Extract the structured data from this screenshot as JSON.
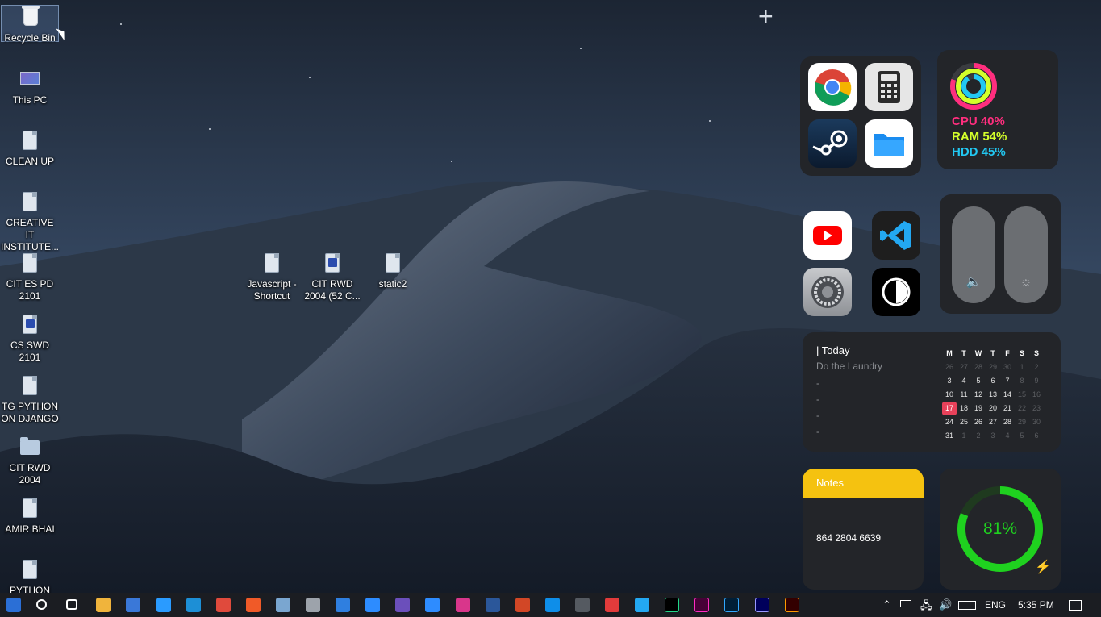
{
  "desktop_icons": [
    {
      "label": "Recycle Bin",
      "icon": "recycle-bin-icon"
    },
    {
      "label": "This PC",
      "icon": "computer-icon"
    },
    {
      "label": "CLEAN UP",
      "icon": "file-icon"
    },
    {
      "label": "CREATIVE IT INSTITUTE...",
      "icon": "file-icon"
    },
    {
      "label": "CIT ES PD 2101",
      "icon": "file-icon"
    },
    {
      "label": "CS SWD 2101",
      "icon": "document-icon"
    },
    {
      "label": "TG PYTHON ON DJANGO",
      "icon": "file-icon"
    },
    {
      "label": "CIT RWD 2004",
      "icon": "folder-icon"
    },
    {
      "label": "AMIR BHAI",
      "icon": "file-icon"
    },
    {
      "label": "PYTHON",
      "icon": "file-icon"
    },
    {
      "label": "Javascript - Shortcut",
      "icon": "file-icon"
    },
    {
      "label": "CIT RWD 2004 (52 C...",
      "icon": "document-icon"
    },
    {
      "label": "static2",
      "icon": "file-icon"
    }
  ],
  "widgets": {
    "apps_top": [
      "Chrome",
      "Calculator",
      "Steam",
      "Files"
    ],
    "apps_bottom": [
      "YouTube",
      "Visual Studio Code",
      "Settings",
      "Dark Mode"
    ],
    "system": {
      "cpu": "CPU 40%",
      "ram": "RAM 54%",
      "hdd": "HDD 45%",
      "cpu_value": 40,
      "ram_value": 54,
      "hdd_value": 45,
      "cpu_color": "#ff2e7e",
      "ram_color": "#d4ff2a",
      "hdd_color": "#22c8f2"
    },
    "sliders": {
      "volume_icon": "speaker-icon",
      "brightness_icon": "sun-icon",
      "volume_level": 0,
      "brightness_level": 0
    },
    "today": {
      "title": "| Today",
      "task": "Do the Laundry",
      "placeholders": [
        "-",
        "-",
        "-",
        "-"
      ]
    },
    "calendar": {
      "weekdays": [
        "M",
        "T",
        "W",
        "T",
        "F",
        "S",
        "S"
      ],
      "weeks": [
        [
          "26",
          "27",
          "28",
          "29",
          "30",
          "1",
          "2"
        ],
        [
          "3",
          "4",
          "5",
          "6",
          "7",
          "8",
          "9"
        ],
        [
          "10",
          "11",
          "12",
          "13",
          "14",
          "15",
          "16"
        ],
        [
          "17",
          "18",
          "19",
          "20",
          "21",
          "22",
          "23"
        ],
        [
          "24",
          "25",
          "26",
          "27",
          "28",
          "29",
          "30"
        ],
        [
          "31",
          "1",
          "2",
          "3",
          "4",
          "5",
          "6"
        ]
      ],
      "today": "17"
    },
    "notes": {
      "title": "Notes",
      "body": "864 2804 6639",
      "header_color": "#f5c210"
    },
    "battery": {
      "percent_label": "81%",
      "value": 81,
      "ring_color": "#1fd11f"
    }
  },
  "taskbar": {
    "apps": [
      "start",
      "search",
      "task-view",
      "file-explorer",
      "store",
      "notepad",
      "edge",
      "chrome",
      "brave",
      "paint",
      "database",
      "mail",
      "zoom",
      "media-player",
      "messenger",
      "instagram",
      "word",
      "powerpoint",
      "teamviewer",
      "obs",
      "photos",
      "vscode",
      "pycharm",
      "adobe-xd",
      "photoshop",
      "premiere",
      "illustrator"
    ],
    "language": "ENG",
    "time": "5:35 PM"
  }
}
